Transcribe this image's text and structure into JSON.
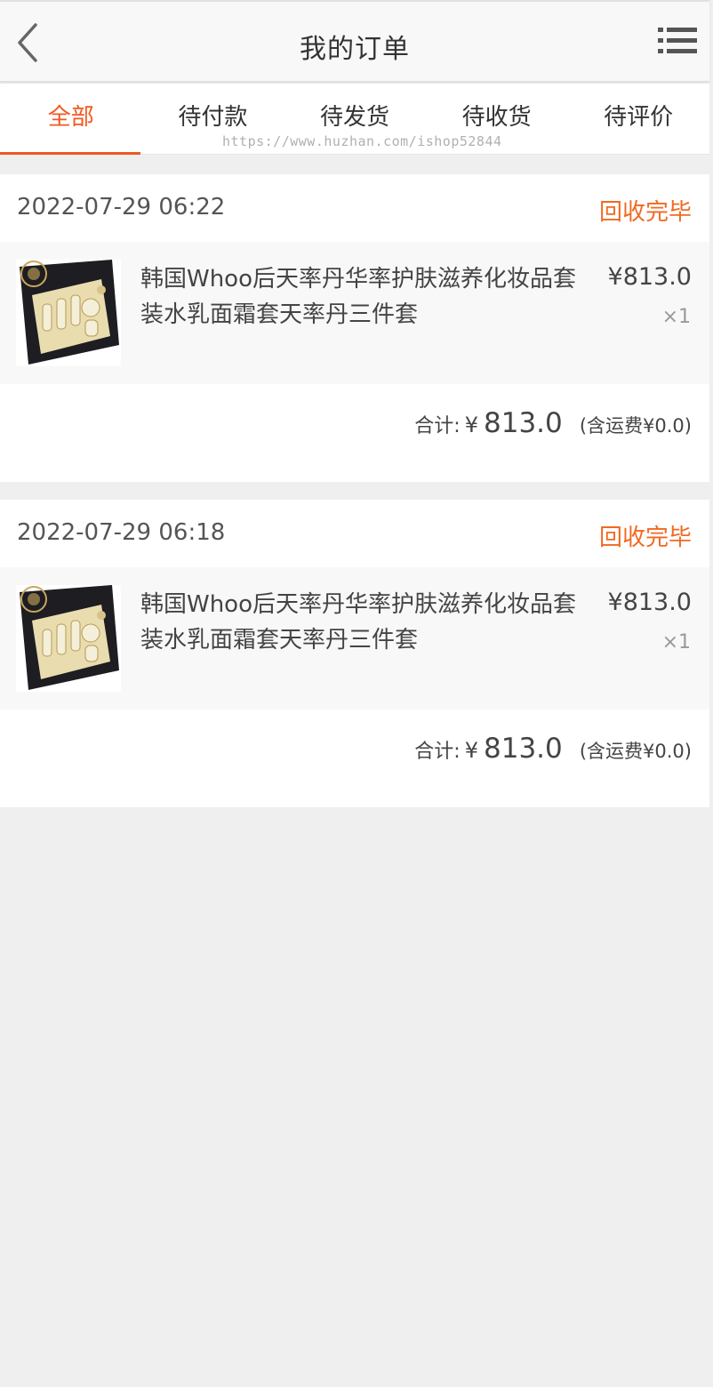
{
  "header": {
    "title": "我的订单",
    "back_icon": "chevron-left-icon",
    "menu_icon": "list-menu-icon"
  },
  "tabs": [
    {
      "label": "全部",
      "active": true
    },
    {
      "label": "待付款",
      "active": false
    },
    {
      "label": "待发货",
      "active": false
    },
    {
      "label": "待收货",
      "active": false
    },
    {
      "label": "待评价",
      "active": false
    }
  ],
  "watermark": "https://www.huzhan.com/ishop52844",
  "colors": {
    "accent": "#f0591f",
    "status": "#f06a22",
    "background": "#efefef"
  },
  "orders": [
    {
      "date": "2022-07-29 06:22",
      "status": "回收完毕",
      "item": {
        "name": "韩国Whoo后天率丹华率护肤滋养化妆品套装水乳面霜套天率丹三件套",
        "price": "¥813.0",
        "qty": "×1"
      },
      "total_label": "合计:",
      "total_currency": "¥",
      "total_amount": "813.0",
      "shipping": "(含运费¥0.0)"
    },
    {
      "date": "2022-07-29 06:18",
      "status": "回收完毕",
      "item": {
        "name": "韩国Whoo后天率丹华率护肤滋养化妆品套装水乳面霜套天率丹三件套",
        "price": "¥813.0",
        "qty": "×1"
      },
      "total_label": "合计:",
      "total_currency": "¥",
      "total_amount": "813.0",
      "shipping": "(含运费¥0.0)"
    }
  ]
}
